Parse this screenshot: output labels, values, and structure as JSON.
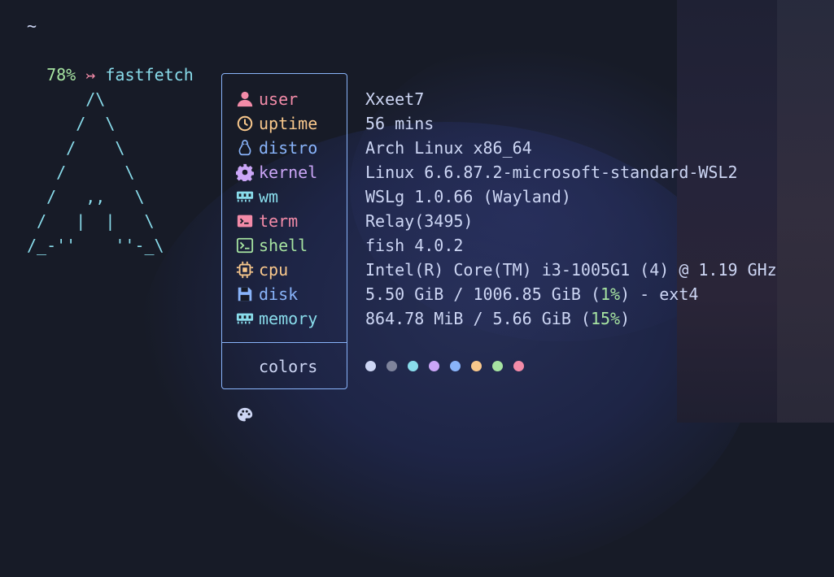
{
  "terminal": {
    "cwd": "~",
    "prompt": {
      "battery": "78%",
      "arrow": "↣",
      "command": "fastfetch"
    },
    "ascii_logo": "      /\\\n     /  \\\n    /    \\\n   /      \\\n  /   ,,   \\\n /   |  |   \\\n/_-''    ''-_\\"
  },
  "info": [
    {
      "key": "user",
      "value": "Xxeet7",
      "icon": "user-icon",
      "color": "#f38ba8"
    },
    {
      "key": "uptime",
      "value": "56 mins",
      "icon": "clock-icon",
      "color": "#f9c88c"
    },
    {
      "key": "distro",
      "value": "Arch Linux x86_64",
      "icon": "linux-penguin-icon",
      "color": "#89b4fa"
    },
    {
      "key": "kernel",
      "value": "Linux 6.6.87.2-microsoft-standard-WSL2",
      "icon": "gear-icon",
      "color": "#cba6f7"
    },
    {
      "key": "wm",
      "value": "WSLg 1.0.66 (Wayland)",
      "icon": "monitor-icon",
      "color": "#89dceb"
    },
    {
      "key": "term",
      "value": "Relay(3495)",
      "icon": "terminal-icon",
      "color": "#f38ba8"
    },
    {
      "key": "shell",
      "value": "fish 4.0.2",
      "icon": "shell-icon",
      "color": "#a6e3a1"
    },
    {
      "key": "cpu",
      "value": "Intel(R) Core(TM) i3-1005G1 (4) @ 1.19 GHz",
      "icon": "chip-icon",
      "color": "#f9c88c"
    },
    {
      "key": "disk",
      "value_pre": "5.50 GiB / 1006.85 GiB (",
      "value_pct": "1%",
      "value_post": ") - ext4",
      "icon": "floppy-disk-icon",
      "color": "#89b4fa"
    },
    {
      "key": "memory",
      "value_pre": "864.78 MiB / 5.66 GiB (",
      "value_pct": "15%",
      "value_post": ")",
      "icon": "memory-icon",
      "color": "#89dceb"
    }
  ],
  "colors": {
    "key": "colors",
    "icon": "palette-icon",
    "swatches": [
      "#cdd6f4",
      "#7f849c",
      "#89dceb",
      "#cba6f7",
      "#89b4fa",
      "#f9c88c",
      "#a6e3a1",
      "#f38ba8"
    ]
  }
}
